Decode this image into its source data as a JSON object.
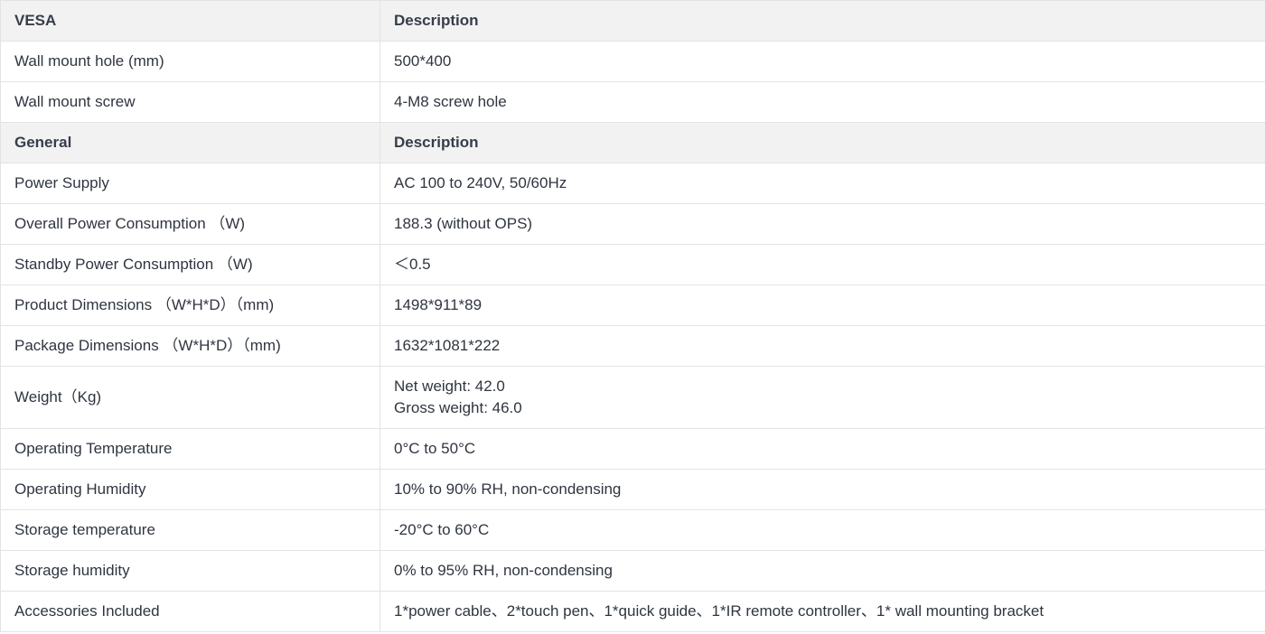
{
  "table": {
    "sections": [
      {
        "header": [
          "VESA",
          "Description"
        ],
        "rows": [
          [
            "Wall mount hole (mm)",
            "500*400"
          ],
          [
            "Wall mount screw",
            "4-M8 screw hole"
          ]
        ]
      },
      {
        "header": [
          "General",
          "Description"
        ],
        "rows": [
          [
            "Power Supply",
            "AC 100 to 240V, 50/60Hz"
          ],
          [
            "Overall Power Consumption （W)",
            "188.3 (without OPS)"
          ],
          [
            "Standby Power Consumption （W)",
            "＜0.5"
          ],
          [
            "Product Dimensions （W*H*D）（mm)",
            "1498*911*89"
          ],
          [
            "Package Dimensions （W*H*D）（mm)",
            "1632*1081*222"
          ],
          [
            "Weight（Kg)",
            [
              "Net weight: 42.0",
              "Gross weight: 46.0"
            ]
          ],
          [
            "Operating Temperature",
            "0°C to 50°C"
          ],
          [
            "Operating Humidity",
            "10% to 90% RH, non-condensing"
          ],
          [
            "Storage temperature",
            "-20°C to 60°C"
          ],
          [
            "Storage humidity",
            "0% to 95% RH, non-condensing"
          ],
          [
            "Accessories Included",
            "1*power cable、2*touch pen、1*quick guide、1*IR remote controller、1* wall mounting bracket"
          ]
        ]
      }
    ]
  }
}
